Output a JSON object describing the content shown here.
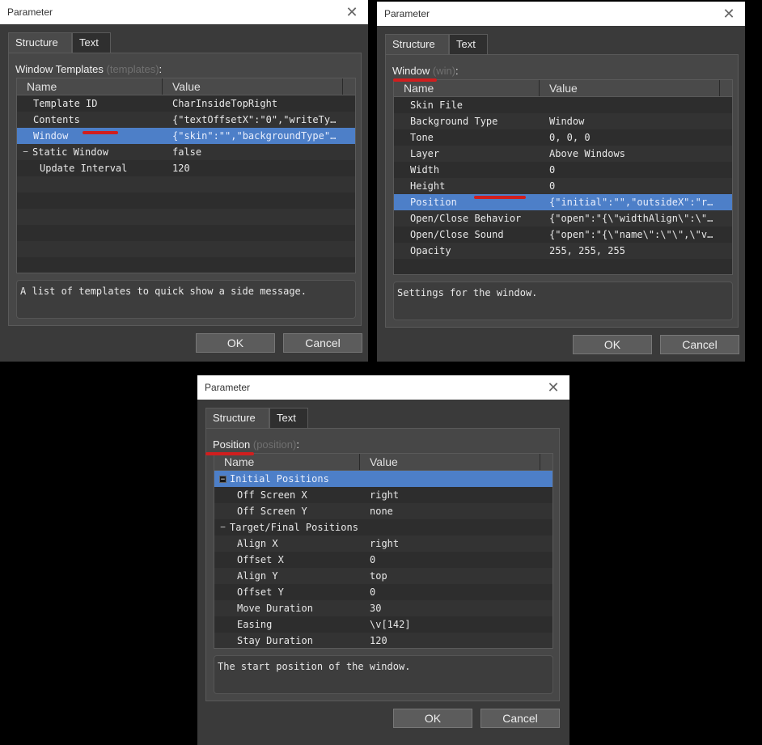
{
  "dialog1": {
    "title": "Parameter",
    "close": "✕",
    "tabs": [
      "Structure",
      "Text"
    ],
    "heading": "Window Templates",
    "heading_key": "(templates)",
    "heading_colon": ":",
    "col_name": "Name",
    "col_value": "Value",
    "rows": [
      {
        "name": "Template ID",
        "value": "CharInsideTopRight"
      },
      {
        "name": "Contents",
        "value": "{\"textOffsetX\":\"0\",\"writeTy…"
      },
      {
        "name": "Window",
        "value": "{\"skin\":\"\",\"backgroundType\"…"
      },
      {
        "name": "Static Window",
        "value": "false"
      },
      {
        "name": "Update Interval",
        "value": "120"
      }
    ],
    "description": "A list of templates to quick show a side message.",
    "ok": "OK",
    "cancel": "Cancel"
  },
  "dialog2": {
    "title": "Parameter",
    "close": "✕",
    "tabs": [
      "Structure",
      "Text"
    ],
    "heading": "Window",
    "heading_key": "(win)",
    "heading_colon": ":",
    "col_name": "Name",
    "col_value": "Value",
    "rows": [
      {
        "name": "Skin File",
        "value": ""
      },
      {
        "name": "Background Type",
        "value": "Window"
      },
      {
        "name": "Tone",
        "value": "0, 0, 0"
      },
      {
        "name": "Layer",
        "value": "Above Windows"
      },
      {
        "name": "Width",
        "value": "0"
      },
      {
        "name": "Height",
        "value": "0"
      },
      {
        "name": "Position",
        "value": "{\"initial\":\"\",\"outsideX\":\"r…"
      },
      {
        "name": "Open/Close Behavior",
        "value": "{\"open\":\"{\\\"widthAlign\\\":\\\"…"
      },
      {
        "name": "Open/Close Sound",
        "value": "{\"open\":\"{\\\"name\\\":\\\"\\\",\\\"v…"
      },
      {
        "name": "Opacity",
        "value": "255, 255, 255"
      }
    ],
    "description": "Settings for the window.",
    "ok": "OK",
    "cancel": "Cancel"
  },
  "dialog3": {
    "title": "Parameter",
    "close": "✕",
    "tabs": [
      "Structure",
      "Text"
    ],
    "heading": "Position",
    "heading_key": "(position)",
    "heading_colon": ":",
    "col_name": "Name",
    "col_value": "Value",
    "rows": [
      {
        "name": "Initial Positions",
        "value": ""
      },
      {
        "name": "Off Screen X",
        "value": "right"
      },
      {
        "name": "Off Screen Y",
        "value": "none"
      },
      {
        "name": "Target/Final Positions",
        "value": ""
      },
      {
        "name": "Align X",
        "value": "right"
      },
      {
        "name": "Offset X",
        "value": "0"
      },
      {
        "name": "Align Y",
        "value": "top"
      },
      {
        "name": "Offset Y",
        "value": "0"
      },
      {
        "name": "Move Duration",
        "value": "30"
      },
      {
        "name": "Easing",
        "value": "\\v[142]"
      },
      {
        "name": "Stay Duration",
        "value": "120"
      }
    ],
    "description": "The start position of the window.",
    "ok": "OK",
    "cancel": "Cancel"
  },
  "colors": {
    "selection": "#4d7fc8",
    "annotation": "#d11e1e",
    "dialog_bg": "#3a3a3a"
  }
}
